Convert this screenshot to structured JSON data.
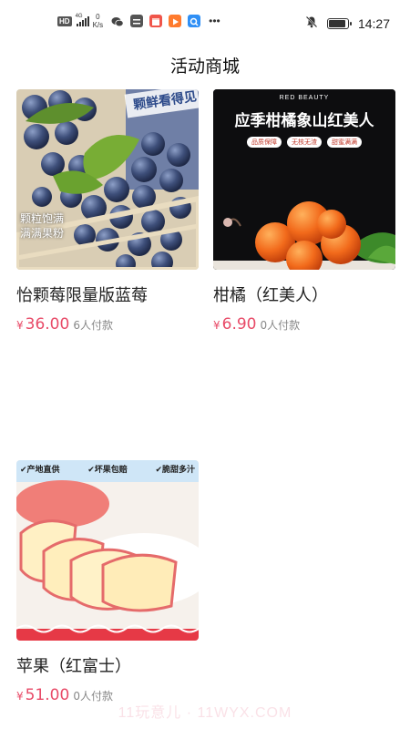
{
  "status_bar": {
    "hd": "HD",
    "network": "4G",
    "speed_value": "0",
    "speed_unit": "K/s",
    "time": "14:27",
    "icons": [
      "hd-icon",
      "signal-icon",
      "wechat-icon",
      "app-icon",
      "store-icon",
      "video-icon",
      "search-app-icon",
      "more-dots-icon",
      "mute-bell-icon",
      "battery-icon"
    ]
  },
  "header": {
    "title": "活动商城"
  },
  "products": [
    {
      "name": "怡颗莓限量版蓝莓",
      "currency": "¥",
      "price": "36.00",
      "sold": "6人付款",
      "image_text": {
        "banner": "颗鲜看得见",
        "caption_line1": "颗粒饱满",
        "caption_line2": "满满果粉"
      }
    },
    {
      "name": "柑橘（红美人）",
      "currency": "¥",
      "price": "6.90",
      "sold": "0人付款",
      "image_text": {
        "brand": "RED BEAUTY",
        "headline": "应季柑橘象山红美人",
        "tag1": "品质保障",
        "tag2": "无核无渣",
        "tag3": "甜蜜满满"
      }
    },
    {
      "name": "苹果（红富士）",
      "currency": "¥",
      "price": "51.00",
      "sold": "0人付款",
      "image_text": {
        "tag1": "✔产地直供",
        "tag2": "✔坏果包赔",
        "tag3": "✔脆甜多汁"
      }
    }
  ],
  "watermark": "11玩意儿 · 11WYX.COM",
  "colors": {
    "price": "#e84b68",
    "background": "#ffffff"
  }
}
